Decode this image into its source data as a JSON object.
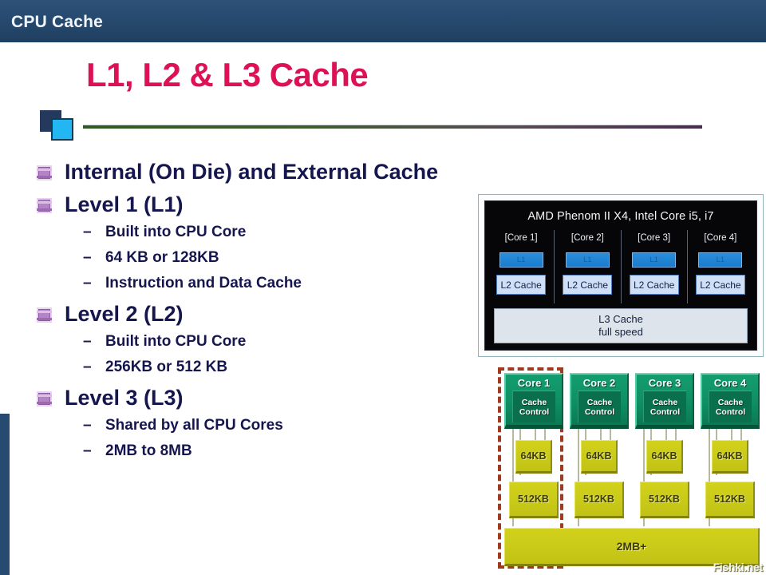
{
  "header": {
    "title": "CPU Cache",
    "bg_color": "#274b70",
    "text_color": "#f2f6fa"
  },
  "slide": {
    "title": "L1, L2 & L3 Cache",
    "title_color": "#dd1155"
  },
  "decor": {
    "square_dark_color": "#24395c",
    "square_cyan_color": "#22b7f2",
    "rule_gradient_from": "#2d5c20",
    "rule_gradient_to": "#4a2d52"
  },
  "bullets": [
    {
      "label": "Internal (On Die) and External Cache",
      "icon": "cube-bullet-icon",
      "sub": []
    },
    {
      "label": "Level 1 (L1)",
      "icon": "cube-bullet-icon",
      "sub": [
        {
          "dash": "–",
          "label": "Built into CPU Core"
        },
        {
          "dash": "–",
          "label": "64 KB or 128KB"
        },
        {
          "dash": "–",
          "label": "Instruction and Data Cache"
        }
      ]
    },
    {
      "label": "Level 2 (L2)",
      "icon": "cube-bullet-icon",
      "sub": [
        {
          "dash": "–",
          "label": "Built into CPU Core"
        },
        {
          "dash": "–",
          "label": "256KB or 512 KB"
        }
      ]
    },
    {
      "label": "Level 3 (L3)",
      "icon": "cube-bullet-icon",
      "sub": [
        {
          "dash": "–",
          "label": "Shared by all CPU Cores"
        },
        {
          "dash": "–",
          "label": "2MB to 8MB"
        }
      ]
    }
  ],
  "die_diagram": {
    "heading": "AMD Phenom II X4, Intel Core i5, i7",
    "cores": [
      {
        "label": "[Core 1]",
        "l1": "L1",
        "l2": "L2 Cache"
      },
      {
        "label": "[Core 2]",
        "l1": "L1",
        "l2": "L2 Cache"
      },
      {
        "label": "[Core 3]",
        "l1": "L1",
        "l2": "L2 Cache"
      },
      {
        "label": "[Core 4]",
        "l1": "L1",
        "l2": "L2 Cache"
      }
    ],
    "l3_line1": "L3 Cache",
    "l3_line2": "full speed",
    "panel_color": "#060608",
    "l1_color": "#1a7ccd",
    "l2_color": "#cfdff5",
    "l3_color": "#dde4ec"
  },
  "tree_diagram": {
    "cores": [
      {
        "title": "Core 1",
        "cc_line1": "Cache",
        "cc_line2": "Control",
        "l1": "64KB",
        "l2": "512KB"
      },
      {
        "title": "Core 2",
        "cc_line1": "Cache",
        "cc_line2": "Control",
        "l1": "64KB",
        "l2": "512KB"
      },
      {
        "title": "Core 3",
        "cc_line1": "Cache",
        "cc_line2": "Control",
        "l1": "64KB",
        "l2": "512KB"
      },
      {
        "title": "Core 4",
        "cc_line1": "Cache",
        "cc_line2": "Control",
        "l1": "64KB",
        "l2": "512KB"
      }
    ],
    "shared": "2MB+",
    "core_color": "#0f8f63",
    "cache_color": "#c2c216",
    "highlight_dash_color": "#a03a1e",
    "watermark": "Fishki.net"
  }
}
